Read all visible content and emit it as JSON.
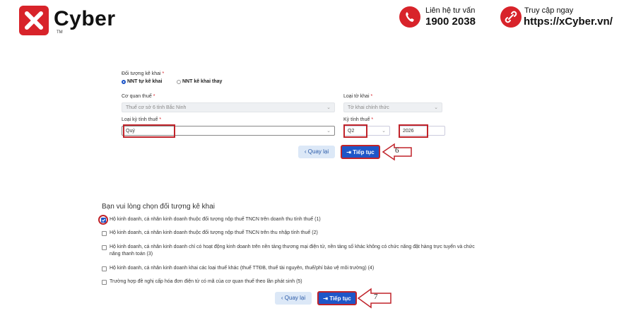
{
  "header": {
    "brand": "Cyber",
    "tm": "TM",
    "contact_label": "Liên hệ tư vấn",
    "contact_phone": "1900 2038",
    "visit_label": "Truy cập ngay",
    "visit_url": "https://xCyber.vn/"
  },
  "form1": {
    "subject_label": "Đối tượng kê khai",
    "req": "*",
    "radio_self": "NNT tự kê khai",
    "radio_proxy": "NNT kê khai thay",
    "tax_office_label": "Cơ quan thuế",
    "tax_office_value": "Thuế cơ sở 6 tỉnh Bắc Ninh",
    "report_type_label": "Loại tờ khai",
    "report_type_value": "Tờ khai chính thức",
    "period_type_label": "Loại kỳ tính thuế",
    "period_type_value": "Quý",
    "period_label": "Kỳ tính thuế",
    "quarter_value": "Q2",
    "year_value": "2026",
    "back_label": "Quay lại",
    "next_label": "Tiếp tục",
    "step": "6"
  },
  "form2": {
    "title": "Bạn vui lòng chọn đối tượng kê khai",
    "options": [
      {
        "line1": "Hộ kinh doanh, cá nhân kinh doanh thuộc đối tượng nộp thuế TNCN trên doanh thu tính thuế (1)",
        "line2": "",
        "checked": true
      },
      {
        "line1": "Hộ kinh doanh, cá nhân kinh doanh thuộc đối tượng nộp thuế TNCN trên thu nhập tính thuế (2)",
        "line2": "",
        "checked": false
      },
      {
        "line1": "Hộ kinh doanh, cá nhân kinh doanh chỉ có hoạt động kinh doanh trên nền tảng thương mại điện tử, nền tảng số khác không có chức năng đặt hàng trực tuyến và chức",
        "line2": "năng thanh toán (3)",
        "checked": false
      },
      {
        "line1": "Hộ kinh doanh, cá nhân kinh doanh khai các loại thuế khác (thuế TTĐB, thuế tài nguyên, thuế/phí bảo vệ môi trường) (4)",
        "line2": "",
        "checked": false
      },
      {
        "line1": "Trường hợp đề nghị cấp hóa đơn điện tử có mã của cơ quan thuế theo lần phát sinh (5)",
        "line2": "",
        "checked": false
      }
    ],
    "back_label": "Quay lại",
    "next_label": "Tiếp tục",
    "step": "7"
  },
  "colors": {
    "brand_red": "#d8232a",
    "primary_blue": "#1e56c8",
    "highlight": "#c0232a"
  }
}
